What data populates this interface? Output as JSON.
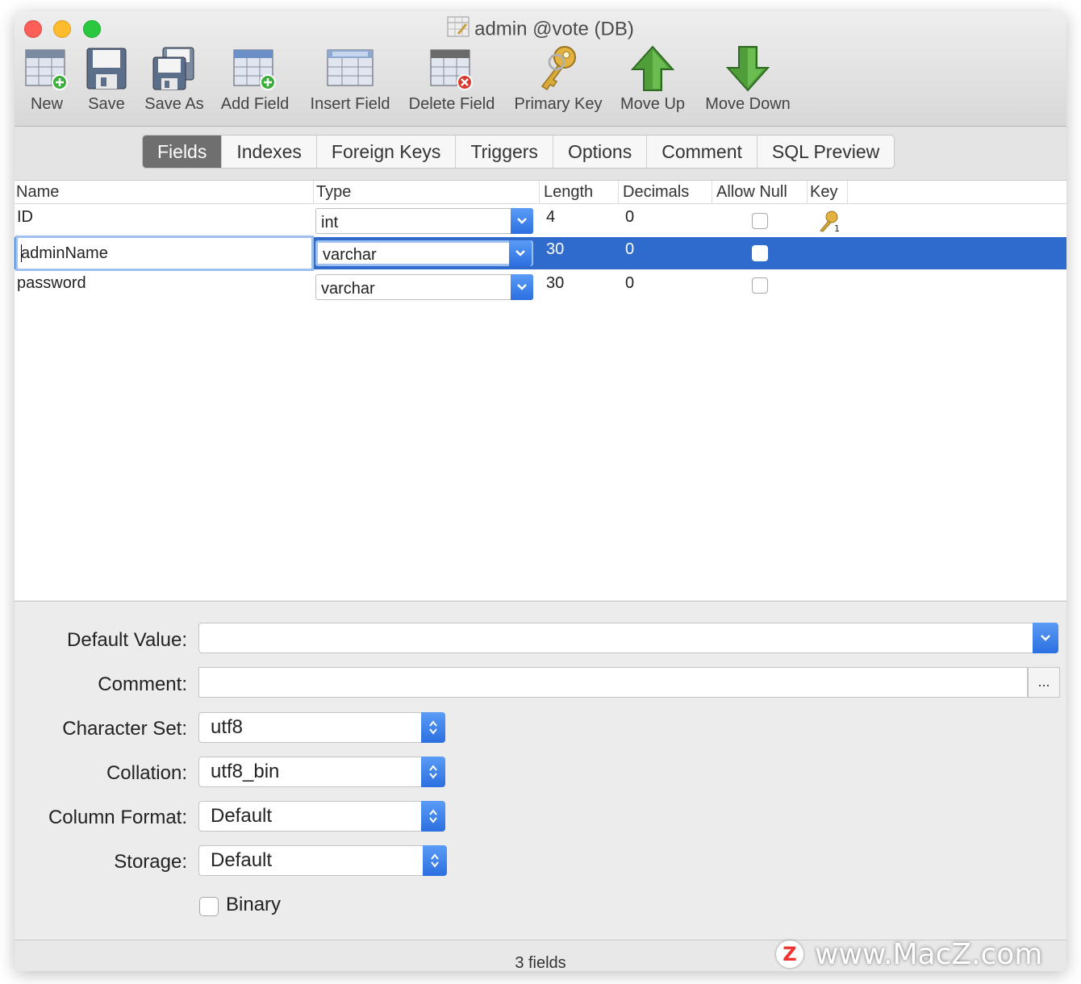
{
  "window": {
    "title": "admin @vote (DB)"
  },
  "toolbar": {
    "new": "New",
    "save": "Save",
    "save_as": "Save As",
    "add_field": "Add Field",
    "insert_field": "Insert Field",
    "delete_field": "Delete Field",
    "primary_key": "Primary Key",
    "move_up": "Move Up",
    "move_down": "Move Down"
  },
  "tabs": [
    "Fields",
    "Indexes",
    "Foreign Keys",
    "Triggers",
    "Options",
    "Comment",
    "SQL Preview"
  ],
  "columns": {
    "name": "Name",
    "type": "Type",
    "length": "Length",
    "decimals": "Decimals",
    "allow_null": "Allow Null",
    "key": "Key"
  },
  "rows": [
    {
      "name": "ID",
      "type": "int",
      "length": "4",
      "decimals": "0",
      "allow_null": false,
      "key": true
    },
    {
      "name": "adminName",
      "type": "varchar",
      "length": "30",
      "decimals": "0",
      "allow_null": false,
      "key": false
    },
    {
      "name": "password",
      "type": "varchar",
      "length": "30",
      "decimals": "0",
      "allow_null": false,
      "key": false
    }
  ],
  "props": {
    "default_value_label": "Default Value:",
    "comment_label": "Comment:",
    "comment_button": "...",
    "charset_label": "Character Set:",
    "charset_value": "utf8",
    "collation_label": "Collation:",
    "collation_value": "utf8_bin",
    "column_format_label": "Column Format:",
    "column_format_value": "Default",
    "storage_label": "Storage:",
    "storage_value": "Default",
    "binary_label": "Binary"
  },
  "status": {
    "text": "3 fields"
  },
  "watermark": {
    "logo": "Z",
    "text": "www.MacZ.com"
  },
  "colors": {
    "selection": "#2f6bcd",
    "accent": "#2c6fe0",
    "active_tab": "#6f6f6f"
  }
}
